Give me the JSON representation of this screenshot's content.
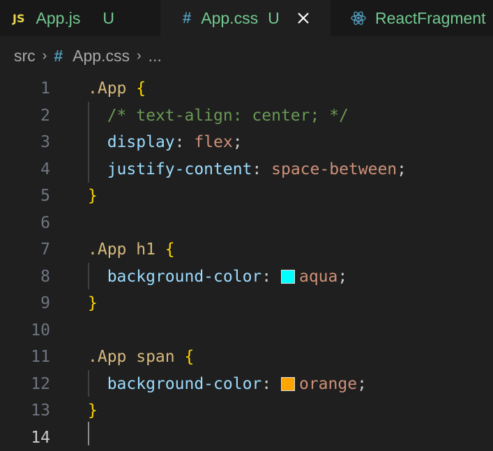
{
  "tabs": [
    {
      "badge": "JS",
      "label": "App.js",
      "status": "U",
      "active": false
    },
    {
      "badge": "#",
      "label": "App.css",
      "status": "U",
      "active": true
    },
    {
      "badge": "react",
      "label": "ReactFragment",
      "status": "",
      "active": false
    }
  ],
  "breadcrumb": {
    "folder": "src",
    "file": "App.css",
    "ellipsis": "..."
  },
  "editor": {
    "line_numbers": [
      "1",
      "2",
      "3",
      "4",
      "5",
      "6",
      "7",
      "8",
      "9",
      "10",
      "11",
      "12",
      "13",
      "14"
    ],
    "current_line": 14,
    "lines": {
      "l1_sel": ".App",
      "l1_brace": "{",
      "l2_comment": "/* text-align: center; */",
      "l3_prop": "display",
      "l3_val": "flex",
      "l4_prop": "justify-content",
      "l4_val": "space-between",
      "l5_brace": "}",
      "l7_sel": ".App h1",
      "l7_brace": "{",
      "l8_prop": "background-color",
      "l8_val": "aqua",
      "l9_brace": "}",
      "l11_sel": ".App span",
      "l11_brace": "{",
      "l12_prop": "background-color",
      "l12_val": "orange",
      "l13_brace": "}",
      "colon": ":",
      "semi": ";"
    },
    "swatches": {
      "aqua": "#00ffff",
      "orange": "#ffa500"
    }
  },
  "colors": {
    "selector": "#d7ba7d",
    "brace": "#ffd700",
    "comment": "#6a9955",
    "property": "#9cdcfe",
    "value": "#ce9178",
    "untracked": "#73c991"
  }
}
